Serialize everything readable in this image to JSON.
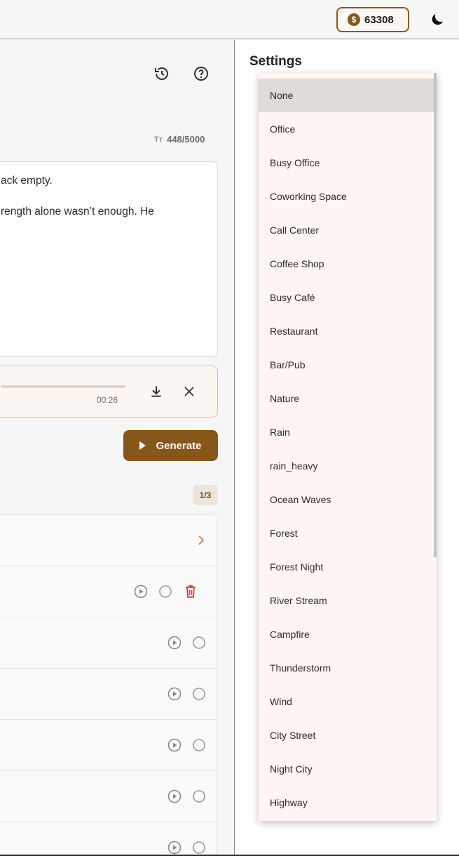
{
  "header": {
    "credits": "63308",
    "credits_icon": "dollar-coin-icon",
    "theme_icon": "moon-icon"
  },
  "editor": {
    "char_count": "448/5000",
    "char_icon_label": "Tт",
    "text_lines": [
      "ack empty.",
      "rength alone wasn’t enough. He"
    ]
  },
  "audio": {
    "time": "00:26",
    "progress": 1.0
  },
  "generate_label": "Generate",
  "history": {
    "page": "1/3"
  },
  "settings": {
    "title": "Settings",
    "options": [
      "None",
      "Office",
      "Busy Office",
      "Coworking Space",
      "Call Center",
      "Coffee Shop",
      "Busy Café",
      "Restaurant",
      "Bar/Pub",
      "Nature",
      "Rain",
      "rain_heavy",
      "Ocean Waves",
      "Forest",
      "Forest Night",
      "River Stream",
      "Campfire",
      "Thunderstorm",
      "Wind",
      "City Street",
      "Night City",
      "Highway"
    ],
    "selected": "None"
  },
  "colors": {
    "accent": "#86561b",
    "delete": "#e53935",
    "dropdown_bg": "#fff5f2"
  }
}
